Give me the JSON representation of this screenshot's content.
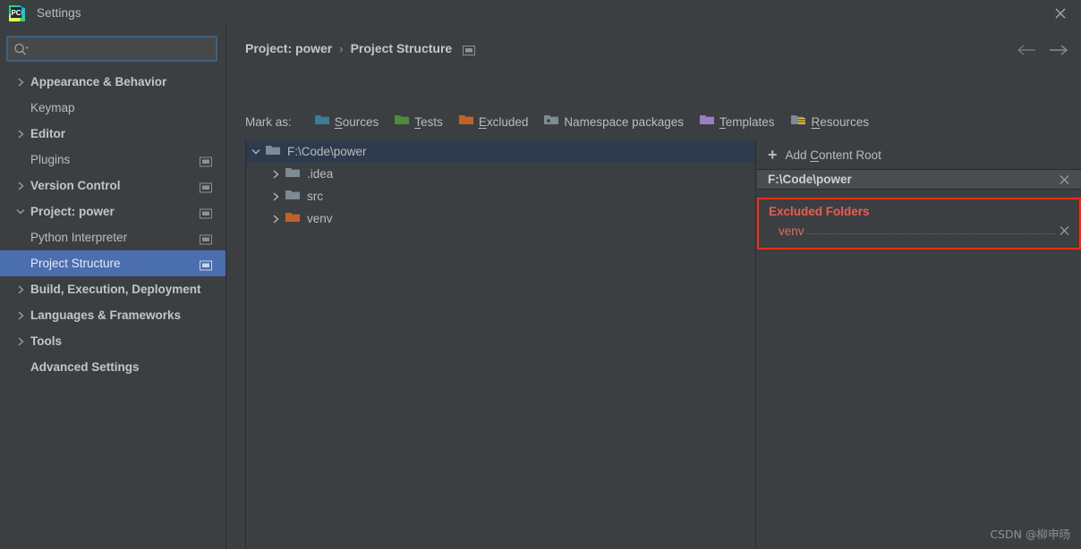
{
  "window": {
    "title": "Settings",
    "logo_icon": "pycharm-logo-icon",
    "close_icon": "close-icon"
  },
  "sidebar": {
    "search": {
      "value": "",
      "placeholder": "",
      "icon": "search-icon",
      "dropdown_icon": "chevron-down-icon"
    },
    "items": [
      {
        "label": "Appearance & Behavior",
        "type": "group",
        "expanded": false,
        "arrow": "chevron-right-icon",
        "badge": false,
        "selected": false
      },
      {
        "label": "Keymap",
        "type": "leaf",
        "expanded": null,
        "arrow": null,
        "badge": false,
        "selected": false
      },
      {
        "label": "Editor",
        "type": "group",
        "expanded": false,
        "arrow": "chevron-right-icon",
        "badge": false,
        "selected": false
      },
      {
        "label": "Plugins",
        "type": "leaf",
        "expanded": null,
        "arrow": null,
        "badge": true,
        "selected": false
      },
      {
        "label": "Version Control",
        "type": "group",
        "expanded": false,
        "arrow": "chevron-right-icon",
        "badge": true,
        "selected": false
      },
      {
        "label": "Project: power",
        "type": "group",
        "expanded": true,
        "arrow": "chevron-down-icon",
        "badge": true,
        "selected": false
      },
      {
        "label": "Python Interpreter",
        "type": "leaf",
        "expanded": null,
        "arrow": null,
        "badge": true,
        "selected": false
      },
      {
        "label": "Project Structure",
        "type": "leaf",
        "expanded": null,
        "arrow": null,
        "badge": true,
        "selected": true
      },
      {
        "label": "Build, Execution, Deployment",
        "type": "group",
        "expanded": false,
        "arrow": "chevron-right-icon",
        "badge": false,
        "selected": false
      },
      {
        "label": "Languages & Frameworks",
        "type": "group",
        "expanded": false,
        "arrow": "chevron-right-icon",
        "badge": false,
        "selected": false
      },
      {
        "label": "Tools",
        "type": "group",
        "expanded": false,
        "arrow": "chevron-right-icon",
        "badge": false,
        "selected": false
      },
      {
        "label": "Advanced Settings",
        "type": "leaf",
        "expanded": null,
        "arrow": null,
        "badge": false,
        "selected": false
      }
    ]
  },
  "main": {
    "breadcrumb": {
      "parent": "Project: power",
      "separator": "›",
      "current": "Project Structure",
      "badge_icon": "project-scope-icon"
    },
    "nav": {
      "back_icon": "arrow-left-icon",
      "forward_icon": "arrow-right-icon"
    },
    "mark_as": {
      "label": "Mark as:",
      "options": [
        {
          "label": "Sources",
          "mnemonic": "S",
          "color": "#3B7C96",
          "icon": "folder-sources-icon"
        },
        {
          "label": "Tests",
          "mnemonic": "T",
          "color": "#4F8A3E",
          "icon": "folder-tests-icon"
        },
        {
          "label": "Excluded",
          "mnemonic": "E",
          "color": "#C1622A",
          "icon": "folder-excluded-icon"
        },
        {
          "label": "Namespace packages",
          "mnemonic": "",
          "color": "#7D8B93",
          "icon": "folder-namespace-icon"
        },
        {
          "label": "Templates",
          "mnemonic": "T",
          "color": "#9A7FC0",
          "icon": "folder-templates-icon"
        },
        {
          "label": "Resources",
          "mnemonic": "R",
          "color": "#7D8B93",
          "icon": "folder-resources-icon"
        }
      ]
    },
    "tree": [
      {
        "name": "F:\\Code\\power",
        "depth": 0,
        "expanded": true,
        "toggle": "chevron-down-icon",
        "folder_color": "#7D8B93",
        "selected": true
      },
      {
        "name": ".idea",
        "depth": 1,
        "expanded": false,
        "toggle": "chevron-right-icon",
        "folder_color": "#7D8B93",
        "selected": false
      },
      {
        "name": "src",
        "depth": 1,
        "expanded": false,
        "toggle": "chevron-right-icon",
        "folder_color": "#7D8B93",
        "selected": false
      },
      {
        "name": "venv",
        "depth": 1,
        "expanded": false,
        "toggle": "chevron-right-icon",
        "folder_color": "#C1622A",
        "selected": false
      }
    ],
    "right_panel": {
      "add_content_root": {
        "label": "Add Content Root",
        "mnemonic": "C",
        "icon": "plus-icon"
      },
      "content_root": {
        "path": "F:\\Code\\power",
        "close_icon": "close-icon"
      },
      "excluded": {
        "title": "Excluded Folders",
        "entries": [
          {
            "name": "venv",
            "close_icon": "close-icon"
          }
        ],
        "highlight_color": "#FF2A16",
        "title_color": "#F05A50",
        "entry_color": "#E06B60"
      }
    }
  },
  "watermark": "CSDN @柳申旸",
  "theme": {
    "background": "#3C3F41",
    "selection_blue": "#4B6EAF",
    "tree_selection": "#2D3B4D",
    "text": "#BBBBBB",
    "border": "#2B2B2B"
  }
}
